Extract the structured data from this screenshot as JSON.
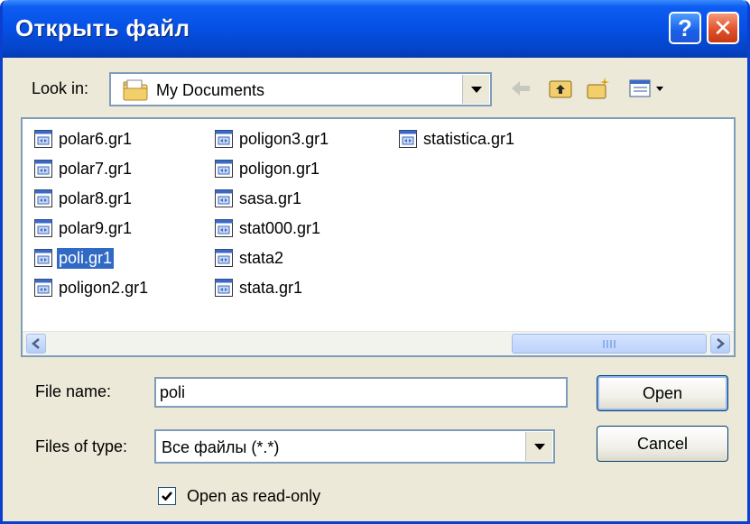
{
  "window": {
    "title": "Открыть файл",
    "help_label": "?",
    "close_label": "✕"
  },
  "toolbar": {
    "lookin_label": "Look in:",
    "lookin_value": "My Documents",
    "icons": [
      "folder-icon",
      "back-arrow-icon",
      "up-folder-icon",
      "new-folder-icon",
      "view-menu-icon"
    ]
  },
  "files": [
    {
      "name": "polar6.gr1"
    },
    {
      "name": "polar7.gr1"
    },
    {
      "name": "polar8.gr1"
    },
    {
      "name": "polar9.gr1"
    },
    {
      "name": "poli.gr1",
      "selected": true
    },
    {
      "name": "poligon2.gr1"
    },
    {
      "name": "poligon3.gr1"
    },
    {
      "name": "poligon.gr1"
    },
    {
      "name": "sasa.gr1"
    },
    {
      "name": "stat000.gr1"
    },
    {
      "name": "stata2"
    },
    {
      "name": "stata.gr1"
    },
    {
      "name": "statistica.gr1"
    }
  ],
  "form": {
    "filename_label": "File name:",
    "filename_value": "poli",
    "filetype_label": "Files of type:",
    "filetype_value": "Все файлы (*.*)",
    "readonly_label": "Open as read-only",
    "readonly_checked": true
  },
  "buttons": {
    "open": "Open",
    "cancel": "Cancel"
  },
  "colors": {
    "selection": "#316ac5",
    "titlebar": "#0650e4",
    "dialog_bg": "#ece9d8"
  }
}
